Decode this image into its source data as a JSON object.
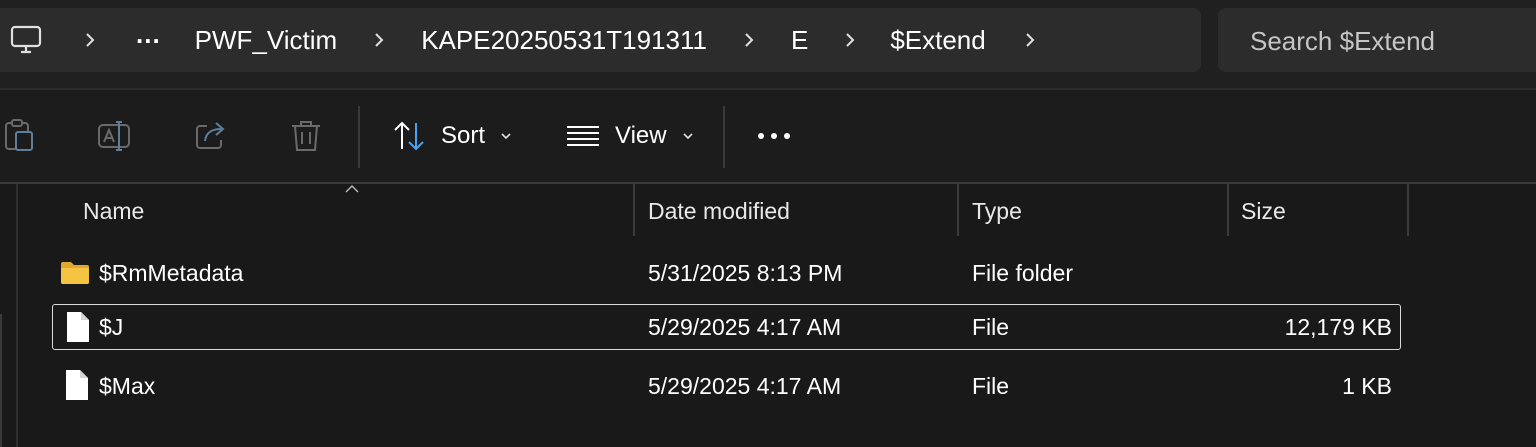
{
  "breadcrumb": {
    "items": [
      "...",
      "PWF_Victim",
      "KAPE20250531T191311",
      "E",
      "$Extend"
    ]
  },
  "search": {
    "placeholder": "Search $Extend"
  },
  "toolbar": {
    "icons": [
      "copy-icon",
      "rename-icon",
      "share-icon",
      "delete-icon"
    ],
    "sort_label": "Sort",
    "view_label": "View",
    "more_label": "•••"
  },
  "columns": {
    "name": "Name",
    "date": "Date modified",
    "type": "Type",
    "size": "Size"
  },
  "files": [
    {
      "name": "$RmMetadata",
      "date": "5/31/2025 8:13 PM",
      "type": "File folder",
      "size": "",
      "icon": "folder-icon"
    },
    {
      "name": "$J",
      "date": "5/29/2025 4:17 AM",
      "type": "File",
      "size": "12,179 KB",
      "icon": "file-icon"
    },
    {
      "name": "$Max",
      "date": "5/29/2025 4:17 AM",
      "type": "File",
      "size": "1 KB",
      "icon": "file-icon"
    }
  ],
  "colors": {
    "background": "#191919",
    "folder": "#f5c342",
    "accent": "#4aa3f0"
  }
}
